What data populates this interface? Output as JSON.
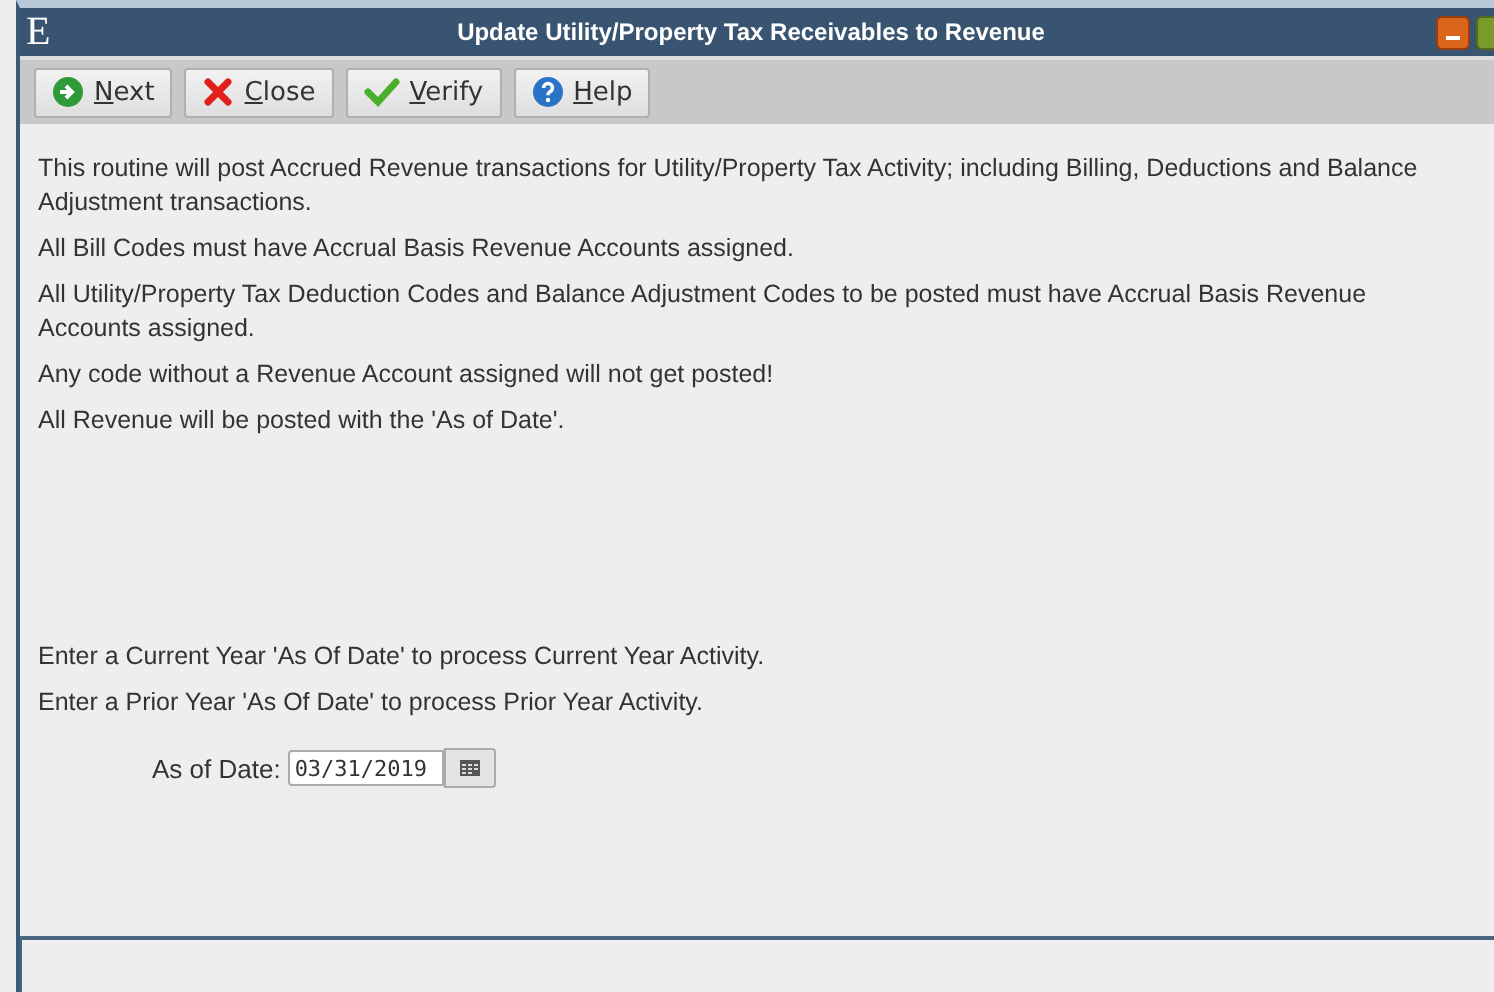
{
  "window": {
    "icon": "E",
    "title": "Update Utility/Property Tax Receivables to Revenue"
  },
  "toolbar": [
    {
      "kind": "next",
      "label": "Next"
    },
    {
      "kind": "close",
      "label": "Close"
    },
    {
      "kind": "verify",
      "label": "Verify"
    },
    {
      "kind": "help",
      "label": "Help"
    }
  ],
  "paragraphs": [
    "This routine will post Accrued Revenue transactions for Utility/Property Tax Activity; including Billing, Deductions and Balance Adjustment transactions.",
    "All Bill Codes must have Accrual Basis Revenue Accounts assigned.",
    "All Utility/Property Tax Deduction Codes and Balance Adjustment Codes to be posted must have Accrual Basis Revenue Accounts assigned.",
    "Any code without a Revenue Account assigned will not get posted!",
    "All Revenue will be posted with the 'As of Date'."
  ],
  "instructions": [
    "Enter a Current Year 'As Of Date' to process Current Year Activity.",
    "Enter a Prior Year 'As Of Date' to process Prior Year Activity."
  ],
  "as_of_date": {
    "label": "As of Date:",
    "value": "03/31/2019"
  }
}
